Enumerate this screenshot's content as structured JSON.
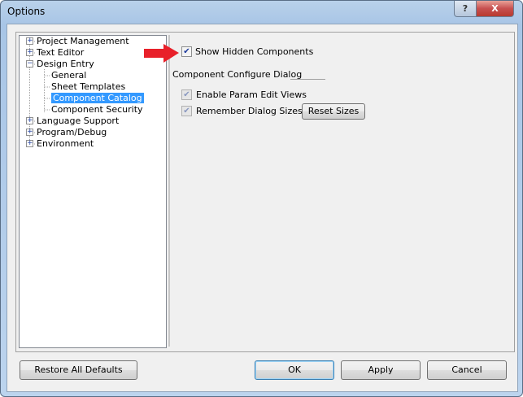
{
  "window": {
    "title": "Options",
    "help_label": "?",
    "close_label": "X"
  },
  "tree": {
    "items": [
      {
        "label": "Project Management",
        "expander": "+"
      },
      {
        "label": "Text Editor",
        "expander": "+"
      },
      {
        "label": "Design Entry",
        "expander": "−"
      },
      {
        "label": "General"
      },
      {
        "label": "Sheet Templates"
      },
      {
        "label": "Component Catalog",
        "selected": true
      },
      {
        "label": "Component Security"
      },
      {
        "label": "Language Support",
        "expander": "+"
      },
      {
        "label": "Program/Debug",
        "expander": "+"
      },
      {
        "label": "Environment",
        "expander": "+"
      }
    ]
  },
  "panel": {
    "show_hidden": {
      "label": "Show Hidden Components",
      "checked": true
    },
    "group_title": "Component Configure Dialog",
    "enable_param": {
      "label": "Enable Param Edit Views",
      "checked": true,
      "disabled": true
    },
    "remember_sizes": {
      "label": "Remember Dialog Sizes",
      "checked": true,
      "disabled": true
    },
    "reset_sizes": "Reset Sizes",
    "check_mark": "✔"
  },
  "annotation": {
    "color": "#e8202a"
  },
  "buttons": {
    "restore": "Restore All Defaults",
    "ok": "OK",
    "apply": "Apply",
    "cancel": "Cancel"
  }
}
